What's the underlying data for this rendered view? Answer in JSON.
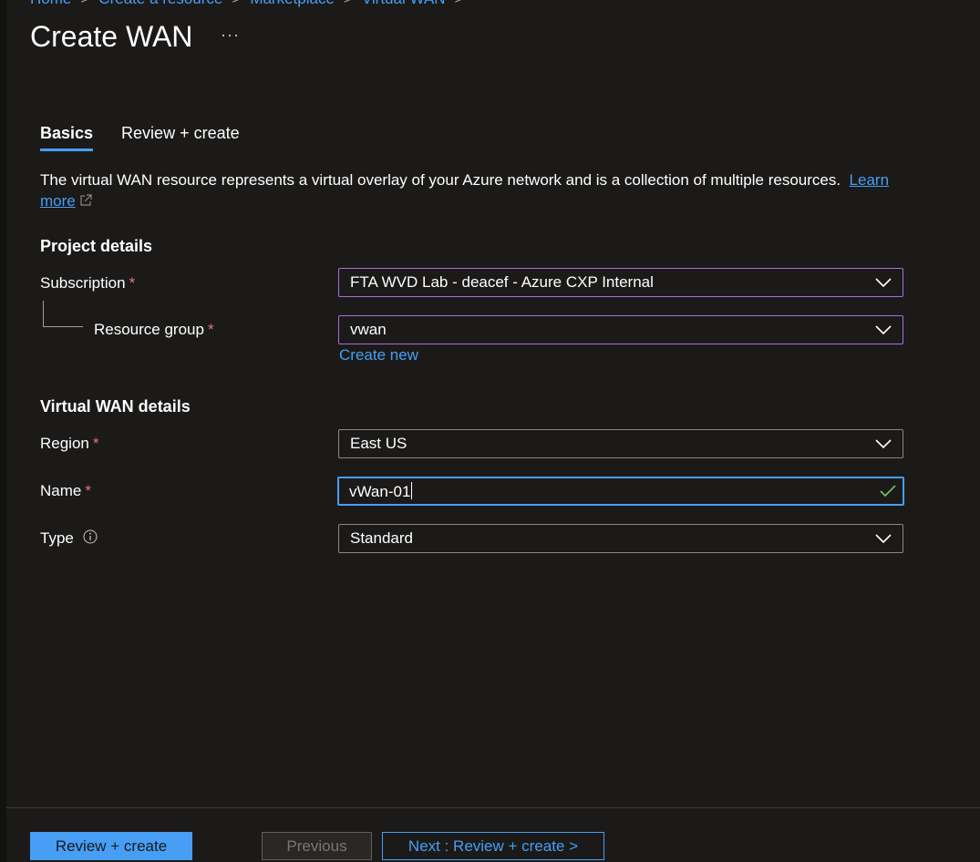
{
  "breadcrumb": {
    "items": [
      "Home",
      "Create a resource",
      "Marketplace",
      "Virtual WAN"
    ],
    "separator": ">"
  },
  "page": {
    "title": "Create WAN",
    "more": "···"
  },
  "tabs": [
    {
      "label": "Basics",
      "active": true
    },
    {
      "label": "Review + create",
      "active": false
    }
  ],
  "description": {
    "text": "The virtual WAN resource represents a virtual overlay of your Azure network and is a collection of multiple resources.",
    "link_learn": "Learn",
    "link_more": "more"
  },
  "project_details": {
    "heading": "Project details",
    "subscription": {
      "label": "Subscription",
      "required": "*",
      "value": "FTA WVD Lab - deacef - Azure CXP Internal"
    },
    "resource_group": {
      "label": "Resource group",
      "required": "*",
      "value": "vwan",
      "create_new": "Create new"
    }
  },
  "wan_details": {
    "heading": "Virtual WAN details",
    "region": {
      "label": "Region",
      "required": "*",
      "value": "East US"
    },
    "name": {
      "label": "Name",
      "required": "*",
      "value": "vWan-01"
    },
    "type": {
      "label": "Type",
      "value": "Standard"
    }
  },
  "footer": {
    "review_create": "Review + create",
    "previous": "Previous",
    "next": "Next : Review + create >"
  },
  "colors": {
    "background": "#1b1a19",
    "accent": "#479ef5",
    "required": "#f1707b",
    "dropdown_highlight": "#a86edc",
    "valid_check": "#6ccb5f"
  },
  "icons": {
    "dropdown": "chevron-down-icon",
    "valid": "checkmark-icon",
    "info": "info-icon",
    "external_link": "external-link-icon"
  }
}
